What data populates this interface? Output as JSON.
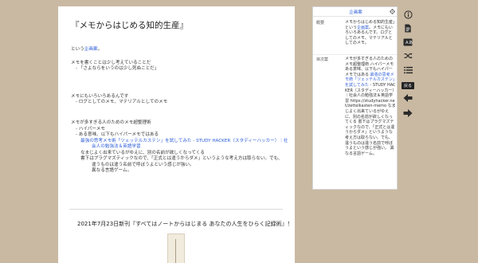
{
  "document": {
    "title": "『メモからはじめる知的生産』",
    "intro_prefix": "という",
    "intro_link": "企画案",
    "intro_suffix": "。",
    "section1": {
      "heading": "メモを書くことは少し考えていることだ",
      "bullet": "「さよならをいうのは少し死ぬことだ」"
    },
    "section2": {
      "heading": "メモにもいろいろあるんです",
      "bullet": "ログとしてのメモ、マテリアルとしてのメモ"
    },
    "section3": {
      "heading": "メモが多すぎる人のためのメモ超整理術",
      "bullet1": "ハイパーメモ",
      "bullet2": "ある意味、以下もハイパーメモではある",
      "link_line1": "最強の思考メモ術「ツェッテルカステン」を試してみた - STUDY HACKER（スタディーハッカー）｜社",
      "link_line2": "会人の勉強法＆英語学習",
      "item1": "なまじよく出来ているがゆえに、別の名前が欲しくなってくる",
      "item2a": "書下はプラグマズティックなので、「正式とは違うからダメ」というような考え方は取らない。でも、",
      "item2b": "違うものは違う名前で呼ぼうよという感じが強い。",
      "item3": "異なる言語ゲーム。"
    },
    "book_line": "2021年7月23日新刊『すべてはノートからはじまる あなたの人生をひらく記録術』！"
  },
  "panel": {
    "title": "企画案",
    "overview_label": "概要",
    "overview_pre": "メモからはじめる知的生産」という",
    "overview_link": "企画案",
    "overview_post": "。メモにもいろいろあるんです。ログとしてのメモ、マテリアルとしてのメモ。",
    "toc_label": "目次案",
    "toc_pre": "メモが多すぎる人のためのメモ超整理術 ハイパーメモ ある意味、以下もハイパーメモではある ",
    "toc_link": "最強の思考メモ術「ツェッテルカステン」を試してみた",
    "toc_post": " - STUDY HACKER（スタディーハッカー）｜社会人の勉強法＆英語学習 https://studyhacker.net/zettelkasten-memo なまじよく出来ているがゆえに、別の名前が欲しくなってくる 書下はプラグマズティックなので、「正式とは違うからダメ」というような考え方は取らない。でも、違うものは違う名前で呼ぼうよという感じが強い。 異なる言語ゲーム。"
  },
  "toolbar": {
    "tooltip": "戻る",
    "icons": [
      "info-icon",
      "document-icon",
      "dictionary-icon",
      "shuffle-icon",
      "list-icon",
      "back-arrow-icon",
      "forward-arrow-icon"
    ]
  },
  "colors": {
    "background": "#c9b9a2",
    "link": "#2a5bd7",
    "toolbar_icon": "#2a2a2a"
  }
}
